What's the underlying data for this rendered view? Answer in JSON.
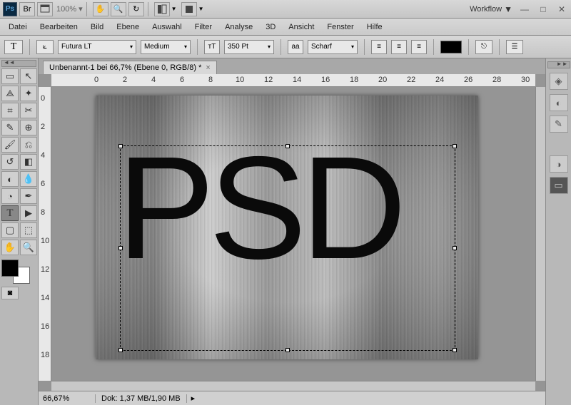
{
  "title": {
    "workflow": "Workflow"
  },
  "zoom_top": "100%",
  "menu": {
    "datei": "Datei",
    "bearbeiten": "Bearbeiten",
    "bild": "Bild",
    "ebene": "Ebene",
    "auswahl": "Auswahl",
    "filter": "Filter",
    "analyse": "Analyse",
    "dd": "3D",
    "ansicht": "Ansicht",
    "fenster": "Fenster",
    "hilfe": "Hilfe"
  },
  "opt": {
    "font": "Futura LT",
    "weight": "Medium",
    "size": "350 Pt",
    "aa_label": "aa",
    "aa": "Scharf"
  },
  "tab": {
    "name": "Unbenannt-1 bei 66,7% (Ebene 0, RGB/8) *"
  },
  "canvas": {
    "text": "PSD"
  },
  "ruler_h": [
    "0",
    "2",
    "4",
    "6",
    "8",
    "10",
    "12",
    "14",
    "16",
    "18",
    "20",
    "22",
    "24",
    "26",
    "28",
    "30"
  ],
  "ruler_v": [
    "0",
    "2",
    "4",
    "6",
    "8",
    "10",
    "12",
    "14",
    "16",
    "18"
  ],
  "status": {
    "zoom": "66,67%",
    "doc": "Dok: 1,37 MB/1,90 MB"
  }
}
